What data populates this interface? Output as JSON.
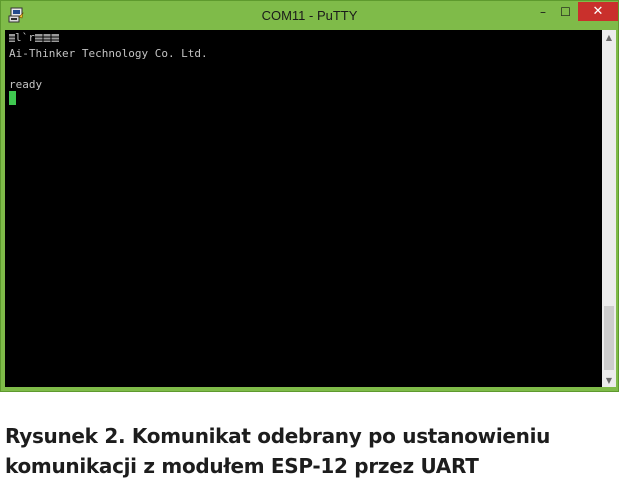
{
  "window": {
    "title": "COM11 - PuTTY",
    "controls": {
      "minimize": "–",
      "maximize": "☐",
      "close": "✕"
    },
    "app_icon": "putty-computer-icon"
  },
  "terminal": {
    "lines": [
      "l`r",
      "Ai-Thinker Technology Co. Ltd.",
      "",
      "ready"
    ]
  },
  "scrollbar": {
    "up": "▲",
    "down": "▼"
  },
  "caption": {
    "line1": "Rysunek 2. Komunikat odebrany po ustanowieniu",
    "line2": "komunikacji z modułem ESP-12 przez UART"
  },
  "colors": {
    "titlebar": "#7fbb49",
    "close_button": "#c9302c",
    "terminal_bg": "#000000",
    "terminal_text": "#c3c3c3",
    "cursor": "#3fc850"
  }
}
